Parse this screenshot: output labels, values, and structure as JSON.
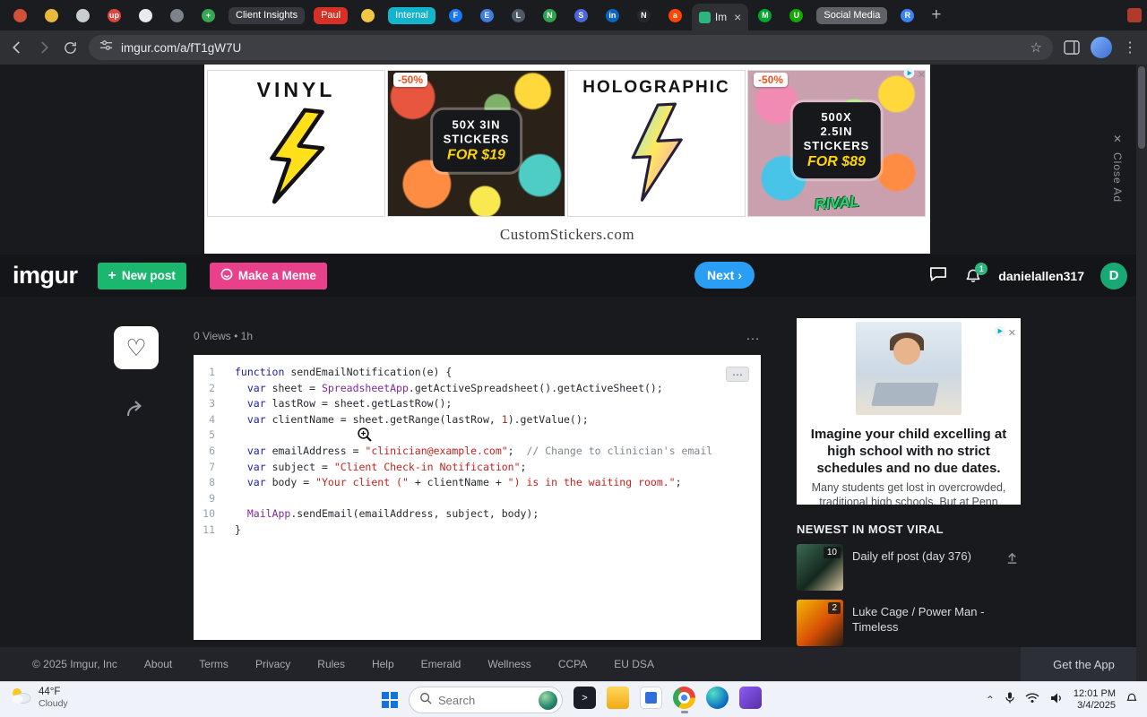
{
  "colors": {
    "imgur_green": "#1bb76e",
    "meme_pink": "#e9408c",
    "next_blue": "#2a9df4",
    "badge_orange": "#f4511e",
    "sticker_yellow": "#ffd400",
    "notification_green": "#2cb67d"
  },
  "browser": {
    "url": "imgur.com/a/fT1gW7U",
    "tabs": [
      {
        "type": "icon",
        "glyph": "",
        "color": "#d05038"
      },
      {
        "type": "icon",
        "glyph": "",
        "color": "#e8b93c"
      },
      {
        "type": "icon",
        "glyph": "",
        "color": "#c8cdd3"
      },
      {
        "type": "icon",
        "glyph": "up",
        "color": "#e0443c"
      },
      {
        "type": "icon",
        "glyph": "",
        "color": "#e8eaed"
      },
      {
        "type": "icon",
        "glyph": "",
        "color": "#7d838c"
      },
      {
        "type": "icon",
        "glyph": "+",
        "color": "#36a854"
      },
      {
        "type": "group",
        "label": "Client Insights",
        "color": "#35383c"
      },
      {
        "type": "group",
        "label": "Paul",
        "color": "#d93025"
      },
      {
        "type": "icon",
        "glyph": "",
        "color": "#f2c744"
      },
      {
        "type": "group",
        "label": "Internal",
        "color": "#12b5cb"
      },
      {
        "type": "icon",
        "glyph": "F",
        "color": "#1877f2"
      },
      {
        "type": "icon",
        "glyph": "E",
        "color": "#3f7de0"
      },
      {
        "type": "icon",
        "glyph": "L",
        "color": "#4f5b66"
      },
      {
        "type": "icon",
        "glyph": "N",
        "color": "#2ea44f"
      },
      {
        "type": "icon",
        "glyph": "S",
        "color": "#4a66d8"
      },
      {
        "type": "icon",
        "glyph": "in",
        "color": "#0a66c2"
      },
      {
        "type": "icon",
        "glyph": "N",
        "color": "#24292f"
      },
      {
        "type": "icon",
        "glyph": "a",
        "color": "#ff4500"
      },
      {
        "type": "active",
        "label": "Im",
        "favicon_color": "#2cb67d"
      },
      {
        "type": "icon",
        "glyph": "M",
        "color": "#00a82d"
      },
      {
        "type": "icon",
        "glyph": "U",
        "color": "#14a800"
      },
      {
        "type": "group",
        "label": "Social Media",
        "color": "#5f6368"
      },
      {
        "type": "icon",
        "glyph": "R",
        "color": "#3b82f6"
      },
      {
        "type": "new"
      },
      {
        "type": "edge-icon",
        "color": "#b03a2e"
      }
    ]
  },
  "ad_banner": {
    "panel1_title": "VINYL",
    "panel2_badge": "-50%",
    "panel2_line1": "50X 3IN",
    "panel2_line2": "STICKERS",
    "panel2_line3": "FOR $19",
    "panel3_title": "HOLOGRAPHIC",
    "panel4_badge": "-50%",
    "panel4_line1": "500X 2.5IN",
    "panel4_line2": "STICKERS",
    "panel4_line3": "FOR $89",
    "panel4_sticker": "RIVAL",
    "domain": "CustomStickers.com",
    "close_ad": "Close Ad"
  },
  "imgur_header": {
    "logo": "imgur",
    "new_post": "New post",
    "make_meme": "Make a Meme",
    "next": "Next",
    "username": "danielallen317",
    "avatar_letter": "D",
    "notification_count": "1"
  },
  "post": {
    "meta": "0 Views • 1h"
  },
  "code": {
    "lines": [
      [
        {
          "t": "kw",
          "v": "function"
        },
        {
          "t": "pl",
          "v": " sendEmailNotification(e) {"
        }
      ],
      [
        {
          "t": "pl",
          "v": "  "
        },
        {
          "t": "kw",
          "v": "var"
        },
        {
          "t": "pl",
          "v": " sheet = "
        },
        {
          "t": "cls",
          "v": "SpreadsheetApp"
        },
        {
          "t": "pl",
          "v": ".getActiveSpreadsheet().getActiveSheet();"
        }
      ],
      [
        {
          "t": "pl",
          "v": "  "
        },
        {
          "t": "kw",
          "v": "var"
        },
        {
          "t": "pl",
          "v": " lastRow = sheet.getLastRow();"
        }
      ],
      [
        {
          "t": "pl",
          "v": "  "
        },
        {
          "t": "kw",
          "v": "var"
        },
        {
          "t": "pl",
          "v": " clientName = sheet.getRange(lastRow, "
        },
        {
          "t": "num",
          "v": "1"
        },
        {
          "t": "pl",
          "v": ").getValue();"
        }
      ],
      [],
      [
        {
          "t": "pl",
          "v": "  "
        },
        {
          "t": "kw",
          "v": "var"
        },
        {
          "t": "pl",
          "v": " emailAddress = "
        },
        {
          "t": "str",
          "v": "\"clinician@example.com\""
        },
        {
          "t": "pl",
          "v": ";  "
        },
        {
          "t": "com",
          "v": "// Change to clinician's email"
        }
      ],
      [
        {
          "t": "pl",
          "v": "  "
        },
        {
          "t": "kw",
          "v": "var"
        },
        {
          "t": "pl",
          "v": " subject = "
        },
        {
          "t": "str",
          "v": "\"Client Check-in Notification\""
        },
        {
          "t": "pl",
          "v": ";"
        }
      ],
      [
        {
          "t": "pl",
          "v": "  "
        },
        {
          "t": "kw",
          "v": "var"
        },
        {
          "t": "pl",
          "v": " body = "
        },
        {
          "t": "str",
          "v": "\"Your client (\""
        },
        {
          "t": "pl",
          "v": " + clientName + "
        },
        {
          "t": "str",
          "v": "\") is in the waiting room.\""
        },
        {
          "t": "pl",
          "v": ";"
        }
      ],
      [],
      [
        {
          "t": "pl",
          "v": "  "
        },
        {
          "t": "cls",
          "v": "MailApp"
        },
        {
          "t": "pl",
          "v": ".sendEmail(emailAddress, subject, body);"
        }
      ],
      [
        {
          "t": "pl",
          "v": "}"
        }
      ]
    ]
  },
  "sidebar": {
    "ad_headline": "Imagine your child excelling at high school with no strict schedules and no due dates.",
    "ad_body": "Many students get lost in overcrowded, traditional high schools. But at Penn",
    "section_title": "NEWEST IN MOST VIRAL",
    "viral_items": [
      {
        "title": "Daily elf post (day 376)",
        "badge": "10"
      },
      {
        "title": "Luke Cage / Power Man - Timeless",
        "badge": "2"
      }
    ]
  },
  "footer": {
    "copyright": "© 2025 Imgur, Inc",
    "links": [
      "About",
      "Terms",
      "Privacy",
      "Rules",
      "Help",
      "Emerald",
      "Wellness",
      "CCPA",
      "EU DSA"
    ],
    "get_app": "Get the App"
  },
  "taskbar": {
    "weather_temp": "44°F",
    "weather_cond": "Cloudy",
    "search_placeholder": "Search",
    "time": "12:01 PM",
    "date": "3/4/2025",
    "apps": [
      {
        "name": "terminal",
        "open": false
      },
      {
        "name": "file-explorer",
        "open": false
      },
      {
        "name": "office-app",
        "open": false
      },
      {
        "name": "chrome",
        "open": true
      },
      {
        "name": "edge",
        "open": false
      },
      {
        "name": "media-app",
        "open": false
      }
    ]
  }
}
